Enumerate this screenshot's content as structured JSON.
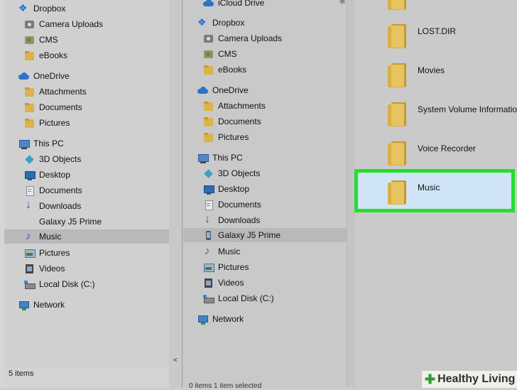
{
  "left_pane": {
    "items": [
      {
        "label": "Dropbox",
        "icon": "dropbox-icon"
      },
      {
        "label": "Camera Uploads",
        "icon": "camera-icon"
      },
      {
        "label": "CMS",
        "icon": "people-icon"
      },
      {
        "label": "eBooks",
        "icon": "folder-icon"
      },
      {
        "label": "OneDrive",
        "icon": "cloud-icon"
      },
      {
        "label": "Attachments",
        "icon": "folder-icon"
      },
      {
        "label": "Documents",
        "icon": "folder-icon"
      },
      {
        "label": "Pictures",
        "icon": "folder-icon"
      },
      {
        "label": "This PC",
        "icon": "pc-icon"
      },
      {
        "label": "3D Objects",
        "icon": "cube-icon"
      },
      {
        "label": "Desktop",
        "icon": "desktop-icon"
      },
      {
        "label": "Documents",
        "icon": "document-icon"
      },
      {
        "label": "Downloads",
        "icon": "download-icon"
      },
      {
        "label": "Galaxy J5 Prime",
        "icon": "phone-icon"
      },
      {
        "label": "Music",
        "icon": "music-icon"
      },
      {
        "label": "Pictures",
        "icon": "pictures-icon"
      },
      {
        "label": "Videos",
        "icon": "videos-icon"
      },
      {
        "label": "Local Disk (C:)",
        "icon": "disk-icon"
      },
      {
        "label": "Network",
        "icon": "network-icon"
      }
    ],
    "status": "5 items",
    "scroll_arrow": "<"
  },
  "mid_pane": {
    "items": [
      {
        "label": "iCloud Drive",
        "icon": "cloud-icon"
      },
      {
        "label": "Dropbox",
        "icon": "dropbox-icon"
      },
      {
        "label": "Camera Uploads",
        "icon": "camera-icon"
      },
      {
        "label": "CMS",
        "icon": "people-icon"
      },
      {
        "label": "eBooks",
        "icon": "folder-icon"
      },
      {
        "label": "OneDrive",
        "icon": "cloud-icon"
      },
      {
        "label": "Attachments",
        "icon": "folder-icon"
      },
      {
        "label": "Documents",
        "icon": "folder-icon"
      },
      {
        "label": "Pictures",
        "icon": "folder-icon"
      },
      {
        "label": "This PC",
        "icon": "pc-icon"
      },
      {
        "label": "3D Objects",
        "icon": "cube-icon"
      },
      {
        "label": "Desktop",
        "icon": "desktop-icon"
      },
      {
        "label": "Documents",
        "icon": "document-icon"
      },
      {
        "label": "Downloads",
        "icon": "download-icon"
      },
      {
        "label": "Galaxy J5 Prime",
        "icon": "phone-icon"
      },
      {
        "label": "Music",
        "icon": "music-icon"
      },
      {
        "label": "Pictures",
        "icon": "pictures-icon"
      },
      {
        "label": "Videos",
        "icon": "videos-icon"
      },
      {
        "label": "Local Disk (C:)",
        "icon": "disk-icon"
      },
      {
        "label": "Network",
        "icon": "network-icon"
      }
    ],
    "status": "0 items     1 item selected"
  },
  "right_pane": {
    "folders": [
      "LOST.DIR",
      "Movies",
      "System Volume Information",
      "Voice Recorder",
      "Music"
    ],
    "highlight_color": "#22e02c"
  },
  "watermark": {
    "text": "Healthy Living",
    "cross": "✚"
  }
}
